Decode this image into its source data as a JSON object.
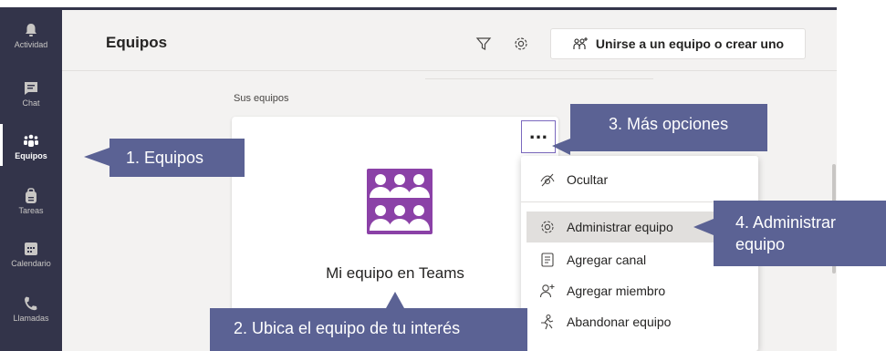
{
  "rail": {
    "items": [
      {
        "label": "Actividad",
        "icon": "bell-icon"
      },
      {
        "label": "Chat",
        "icon": "chat-icon"
      },
      {
        "label": "Equipos",
        "icon": "teams-icon"
      },
      {
        "label": "Tareas",
        "icon": "tasks-icon"
      },
      {
        "label": "Calendario",
        "icon": "calendar-icon"
      },
      {
        "label": "Llamadas",
        "icon": "phone-icon"
      }
    ],
    "active": "Equipos"
  },
  "header": {
    "title": "Equipos",
    "join_button": "Unirse a un equipo o crear uno"
  },
  "main": {
    "section_title": "Sus equipos",
    "team_card": {
      "name": "Mi equipo en Teams",
      "more_label": "..."
    }
  },
  "menu": {
    "items": [
      {
        "label": "Ocultar",
        "icon": "hide-icon"
      },
      {
        "label": "Administrar equipo",
        "icon": "gear-icon"
      },
      {
        "label": "Agregar canal",
        "icon": "channel-icon"
      },
      {
        "label": "Agregar miembro",
        "icon": "add-member-icon"
      },
      {
        "label": "Abandonar equipo",
        "icon": "leave-icon"
      }
    ],
    "highlighted": "Administrar equipo"
  },
  "callouts": {
    "c1": "1. Equipos",
    "c2": "2. Ubica el equipo de tu interés",
    "c3": "3. Más opciones",
    "c4": "4. Administrar equipo"
  },
  "colors": {
    "rail": "#33344a",
    "accent": "#7b69be",
    "callout": "#5b6294",
    "team_avatar": "#8b41a7"
  }
}
